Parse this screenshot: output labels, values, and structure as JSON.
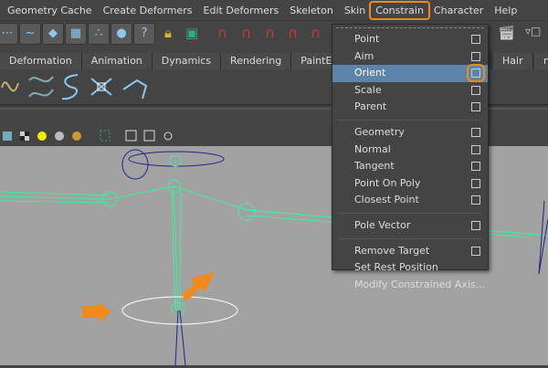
{
  "menubar": {
    "items": [
      "Geometry Cache",
      "Create Deformers",
      "Edit Deformers",
      "Skeleton",
      "Skin",
      "Constrain",
      "Character",
      "Help"
    ],
    "active": "Constrain"
  },
  "shelf_tabs": [
    "Deformation",
    "Animation",
    "Dynamics",
    "Rendering",
    "PaintEffects",
    "Hair",
    "n"
  ],
  "toolbar": {
    "help_icon": "?"
  },
  "constrain_menu": {
    "groups": [
      [
        {
          "label": "Point",
          "option_box": true
        },
        {
          "label": "Aim",
          "option_box": true
        },
        {
          "label": "Orient",
          "option_box": true,
          "highlighted": true
        },
        {
          "label": "Scale",
          "option_box": true
        },
        {
          "label": "Parent",
          "option_box": true
        }
      ],
      [
        {
          "label": "Geometry",
          "option_box": true
        },
        {
          "label": "Normal",
          "option_box": true
        },
        {
          "label": "Tangent",
          "option_box": true
        },
        {
          "label": "Point On Poly",
          "option_box": true
        },
        {
          "label": "Closest Point",
          "option_box": true
        }
      ],
      [
        {
          "label": "Pole Vector",
          "option_box": true
        }
      ],
      [
        {
          "label": "Remove Target",
          "option_box": true
        },
        {
          "label": "Set Rest Position",
          "option_box": false
        },
        {
          "label": "Modify Constrained Axis...",
          "option_box": false
        }
      ]
    ]
  },
  "colors": {
    "highlight": "#f08a1c",
    "menu_selected": "#5f84aa",
    "joint": "#3cf0a0",
    "viewport_bg": "#a2a2a2"
  }
}
